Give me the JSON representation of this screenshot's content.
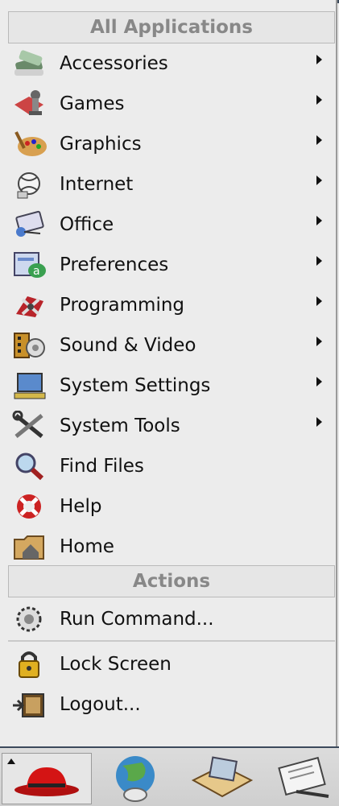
{
  "menu": {
    "header_apps": "All Applications",
    "items": [
      {
        "label": "Accessories",
        "icon": "accessories-icon",
        "submenu": true
      },
      {
        "label": "Games",
        "icon": "games-icon",
        "submenu": true
      },
      {
        "label": "Graphics",
        "icon": "graphics-icon",
        "submenu": true
      },
      {
        "label": "Internet",
        "icon": "internet-icon",
        "submenu": true
      },
      {
        "label": "Office",
        "icon": "office-icon",
        "submenu": true
      },
      {
        "label": "Preferences",
        "icon": "preferences-icon",
        "submenu": true
      },
      {
        "label": "Programming",
        "icon": "programming-icon",
        "submenu": true
      },
      {
        "label": "Sound & Video",
        "icon": "sound-video-icon",
        "submenu": true
      },
      {
        "label": "System Settings",
        "icon": "system-settings-icon",
        "submenu": true
      },
      {
        "label": "System Tools",
        "icon": "system-tools-icon",
        "submenu": true
      },
      {
        "label": "Find Files",
        "icon": "find-files-icon",
        "submenu": false
      },
      {
        "label": "Help",
        "icon": "help-icon",
        "submenu": false
      },
      {
        "label": "Home",
        "icon": "home-folder-icon",
        "submenu": false
      }
    ],
    "header_actions": "Actions",
    "actions": [
      {
        "label": "Run Command...",
        "icon": "run-command-icon"
      },
      {
        "label": "Lock Screen",
        "icon": "lock-icon"
      },
      {
        "label": "Logout...",
        "icon": "logout-icon"
      }
    ]
  },
  "panel": {
    "launchers": [
      "main-menu-redhat-icon",
      "web-browser-icon",
      "email-icon",
      "office-writer-icon"
    ]
  },
  "colors": {
    "menu_bg": "#ececec",
    "header_text": "#888888",
    "border_dark": "#3c4a5c"
  }
}
